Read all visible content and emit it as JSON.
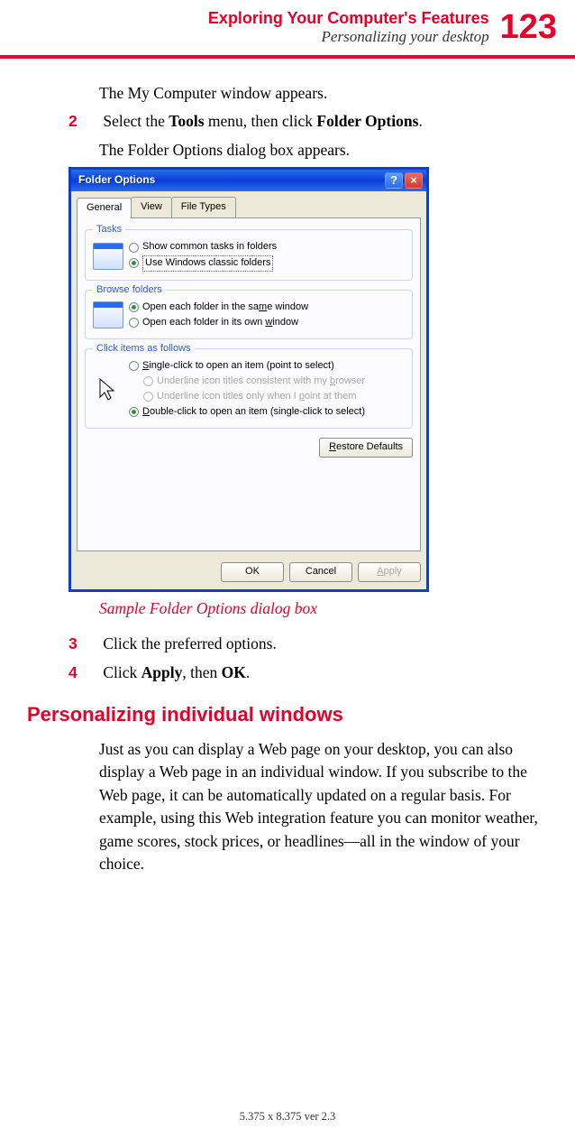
{
  "header": {
    "chapter": "Exploring Your Computer's Features",
    "section": "Personalizing your desktop",
    "page": "123"
  },
  "body": {
    "p1": "The My Computer window appears.",
    "step2_pre": "Select the ",
    "step2_b1": "Tools",
    "step2_mid": " menu, then click ",
    "step2_b2": "Folder Options",
    "step2_end": ".",
    "p2": "The Folder Options dialog box appears.",
    "caption": "Sample Folder Options dialog box",
    "step3": "Click the preferred options.",
    "step4_pre": "Click ",
    "step4_b1": "Apply",
    "step4_mid": ", then ",
    "step4_b2": "OK",
    "step4_end": ".",
    "subhead": "Personalizing individual windows",
    "para": "Just as you can display a Web page on your desktop, you can also display a Web page in an individual window. If you subscribe to the Web page, it can be automatically updated on a regular basis. For example, using this Web integration feature you can monitor weather, game scores, stock prices, or headlines—all in the window of your choice."
  },
  "steps": {
    "n2": "2",
    "n3": "3",
    "n4": "4"
  },
  "dialog": {
    "title": "Folder Options",
    "help": "?",
    "close": "×",
    "tabs": {
      "general": "General",
      "view": "View",
      "ftypes": "File Types"
    },
    "tasks": {
      "legend": "Tasks",
      "opt1": "Show common tasks in folders",
      "opt2": "Use Windows classic folders"
    },
    "browse": {
      "legend": "Browse folders",
      "opt1_a": "Open each folder in the sa",
      "opt1_u": "m",
      "opt1_b": "e window",
      "opt2_a": "Open each folder in its own ",
      "opt2_u": "w",
      "opt2_b": "indow"
    },
    "click": {
      "legend": "Click items as follows",
      "opt1_u": "S",
      "opt1_b": "ingle-click to open an item (point to select)",
      "sub1_a": "Underline icon titles consistent with my ",
      "sub1_u": "b",
      "sub1_b": "rowser",
      "sub2_a": "Underline icon titles only when I ",
      "sub2_u": "p",
      "sub2_b": "oint at them",
      "opt2_u": "D",
      "opt2_b": "ouble-click to open an item (single-click to select)"
    },
    "buttons": {
      "restore_u": "R",
      "restore_b": "estore Defaults",
      "ok": "OK",
      "cancel": "Cancel",
      "apply_u": "A",
      "apply_b": "pply"
    }
  },
  "footer": "5.375 x 8.375 ver 2.3"
}
